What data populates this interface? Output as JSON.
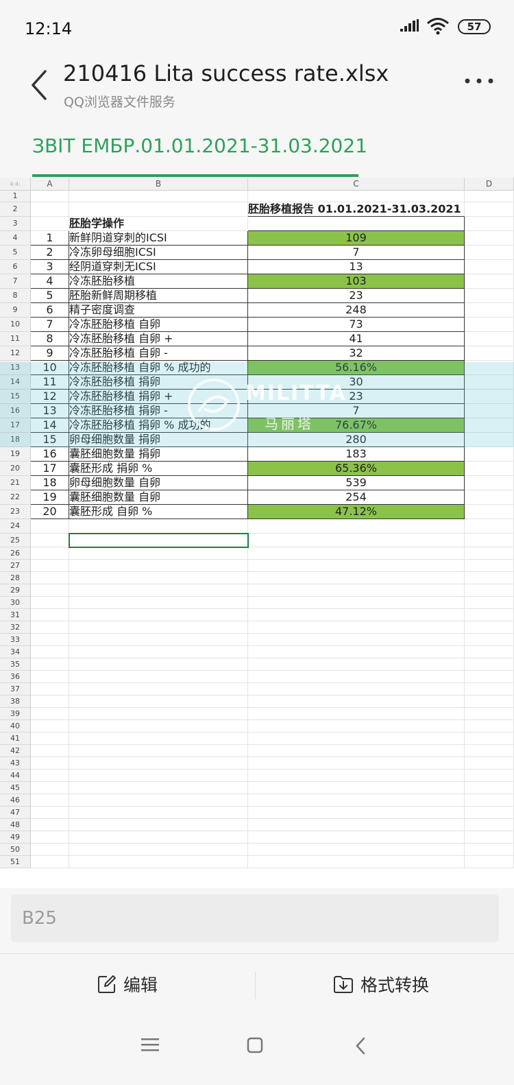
{
  "status_bar": {
    "time": "12:14",
    "battery": "57",
    "signal_icon": "signal-icon",
    "wifi_icon": "wifi-icon"
  },
  "header": {
    "title": "210416 Lita success rate.xlsx",
    "subtitle": "QQ浏览器文件服务",
    "back_icon": "back-arrow-icon",
    "more_icon": "more-dots-icon"
  },
  "sheet_tab": {
    "name": "ЗВІТ ЕМБР.01.01.2021-31.03.2021",
    "accent": "#2ea05a"
  },
  "grid": {
    "corner": "4:4:",
    "columns": [
      "A",
      "B",
      "C",
      "D"
    ],
    "row_numbers": [
      "1",
      "2",
      "3",
      "4",
      "5",
      "6",
      "7",
      "8",
      "9",
      "10",
      "11",
      "12",
      "13",
      "14",
      "15",
      "16",
      "17",
      "18",
      "19",
      "20",
      "21",
      "22",
      "23",
      "24",
      "25",
      "26",
      "27",
      "28",
      "29",
      "30",
      "31",
      "32",
      "33",
      "34",
      "35",
      "36",
      "37",
      "38",
      "39",
      "40",
      "41",
      "42",
      "43",
      "44",
      "45",
      "46",
      "47",
      "48",
      "49",
      "50",
      "51"
    ],
    "c2_header": "胚胎移植报告 01.01.2021-31.03.2021",
    "b3_section": "胚胎学操作",
    "rows": [
      {
        "a": "1",
        "b": "新鲜阴道穿刺的ICSI",
        "c": "109",
        "highlight": true
      },
      {
        "a": "2",
        "b": "冷冻卵母细胞ICSI",
        "c": "7",
        "highlight": false
      },
      {
        "a": "3",
        "b": "经阴道穿刺无ICSI",
        "c": "13",
        "highlight": false
      },
      {
        "a": "4",
        "b": "冷冻胚胎移植",
        "c": "103",
        "highlight": true
      },
      {
        "a": "5",
        "b": "胚胎新鲜周期移植",
        "c": "23",
        "highlight": false
      },
      {
        "a": "6",
        "b": "精子密度调查",
        "c": "248",
        "highlight": false
      },
      {
        "a": "7",
        "b": "冷冻胚胎移植  自卵",
        "c": "73",
        "highlight": false
      },
      {
        "a": "8",
        "b": "冷冻胚胎移植  自卵 +",
        "c": "41",
        "highlight": false
      },
      {
        "a": "9",
        "b": "冷冻胚胎移植  自卵  -",
        "c": "32",
        "highlight": false
      },
      {
        "a": "10",
        "b": "冷冻胚胎移植  自卵 % 成功的",
        "c": "56.16%",
        "highlight": true
      },
      {
        "a": "11",
        "b": "冷冻胚胎移植  捐卵",
        "c": "30",
        "highlight": false
      },
      {
        "a": "12",
        "b": "冷冻胚胎移植  捐卵  +",
        "c": "23",
        "highlight": false
      },
      {
        "a": "13",
        "b": "冷冻胚胎移植  捐卵  -",
        "c": "7",
        "highlight": false
      },
      {
        "a": "14",
        "b": "冷冻胚胎移植  捐卵  % 成功的",
        "c": "76.67%",
        "highlight": true
      },
      {
        "a": "15",
        "b": "卵母细胞数量 捐卵",
        "c": "280",
        "highlight": false
      },
      {
        "a": "16",
        "b": "囊胚细胞数量  捐卵",
        "c": "183",
        "highlight": false
      },
      {
        "a": "17",
        "b": " 囊胚形成 捐卵 %",
        "c": "65.36%",
        "highlight": true
      },
      {
        "a": "18",
        "b": "卵母细胞数量 自卵",
        "c": "539",
        "highlight": false
      },
      {
        "a": "19",
        "b": "囊胚细胞数量  自卵",
        "c": "254",
        "highlight": false
      },
      {
        "a": "20",
        "b": "囊胚形成  自卵  %",
        "c": "47.12%",
        "highlight": true
      }
    ],
    "highlight_color": "#8bc34a"
  },
  "watermark": {
    "text_en": "MILITTA",
    "text_cn": "马丽塔"
  },
  "name_box": {
    "value": "B25"
  },
  "toolbar": {
    "edit_label": "编辑",
    "edit_icon": "edit-icon",
    "convert_label": "格式转换",
    "convert_icon": "convert-download-icon"
  },
  "navbar": {
    "menu_icon": "menu-icon",
    "home_icon": "home-icon",
    "back_icon": "nav-back-icon"
  }
}
